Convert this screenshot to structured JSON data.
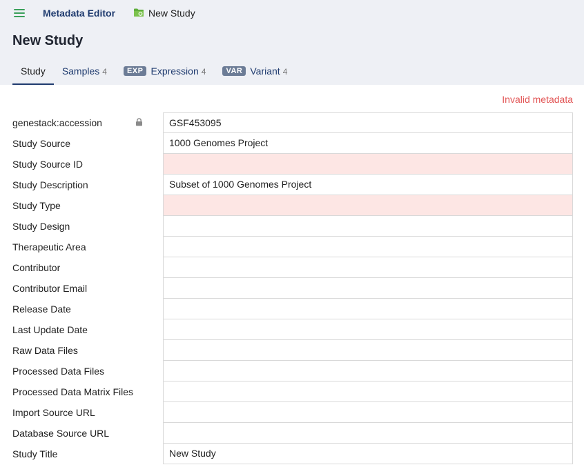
{
  "header": {
    "app_title": "Metadata Editor",
    "breadcrumb_label": "New Study",
    "page_title": "New Study",
    "icons": {
      "menu": "hamburger-icon",
      "breadcrumb": "folder-icon"
    }
  },
  "tabs": [
    {
      "label": "Study",
      "count": "",
      "badge": ""
    },
    {
      "label": "Samples",
      "count": "4",
      "badge": ""
    },
    {
      "label": "Expression",
      "count": "4",
      "badge": "EXP"
    },
    {
      "label": "Variant",
      "count": "4",
      "badge": "VAR"
    }
  ],
  "status_text": "Invalid metadata",
  "colors": {
    "accent": "#1e3a6e",
    "error_text": "#e25555",
    "invalid_fill": "#fde6e4",
    "menu_green": "#3aa05a"
  },
  "fields": [
    {
      "label": "genestack:accession",
      "value": "GSF453095",
      "locked": true,
      "invalid": false
    },
    {
      "label": "Study Source",
      "value": "1000 Genomes Project",
      "invalid": false
    },
    {
      "label": "Study Source ID",
      "value": "",
      "invalid": true
    },
    {
      "label": "Study Description",
      "value": "Subset of 1000 Genomes Project",
      "invalid": false
    },
    {
      "label": "Study Type",
      "value": "",
      "invalid": true
    },
    {
      "label": "Study Design",
      "value": "",
      "invalid": false
    },
    {
      "label": "Therapeutic Area",
      "value": "",
      "invalid": false
    },
    {
      "label": "Contributor",
      "value": "",
      "invalid": false
    },
    {
      "label": "Contributor Email",
      "value": "",
      "invalid": false
    },
    {
      "label": "Release Date",
      "value": "",
      "invalid": false
    },
    {
      "label": "Last Update Date",
      "value": "",
      "invalid": false
    },
    {
      "label": "Raw Data Files",
      "value": "",
      "invalid": false
    },
    {
      "label": "Processed Data Files",
      "value": "",
      "invalid": false
    },
    {
      "label": "Processed Data Matrix Files",
      "value": "",
      "invalid": false
    },
    {
      "label": "Import Source URL",
      "value": "",
      "invalid": false
    },
    {
      "label": "Database Source URL",
      "value": "",
      "invalid": false
    },
    {
      "label": "Study Title",
      "value": "New Study",
      "invalid": false
    }
  ]
}
